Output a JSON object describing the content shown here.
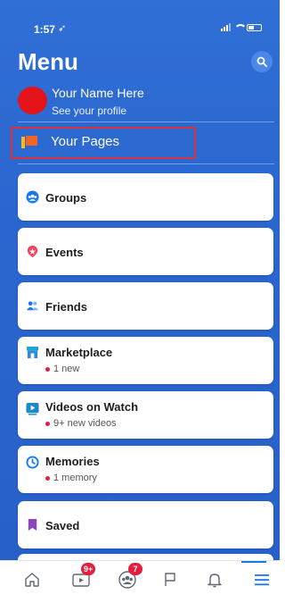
{
  "status_bar": {
    "time": "1:57",
    "location_glyph": "➶"
  },
  "header": {
    "title": "Menu"
  },
  "profile": {
    "name": "Your Name Here",
    "subtitle": "See your profile"
  },
  "pages": {
    "label": "Your Pages"
  },
  "menu_items": [
    {
      "label": "Groups",
      "icon": "groups-icon"
    },
    {
      "label": "Events",
      "icon": "events-icon"
    },
    {
      "label": "Friends",
      "icon": "friends-icon"
    },
    {
      "label": "Marketplace",
      "sub": "1 new",
      "icon": "marketplace-icon"
    },
    {
      "label": "Videos on Watch",
      "sub": "9+ new videos",
      "icon": "watch-icon"
    },
    {
      "label": "Memories",
      "sub": "1 memory",
      "icon": "memories-icon"
    },
    {
      "label": "Saved",
      "icon": "saved-icon"
    }
  ],
  "tab_bar": {
    "badges": {
      "watch": "9+",
      "groups": "7"
    }
  },
  "colors": {
    "accent": "#1877f2",
    "background": "#2a66cf",
    "badge": "#e41e3f",
    "highlight_box": "#d8323d"
  }
}
